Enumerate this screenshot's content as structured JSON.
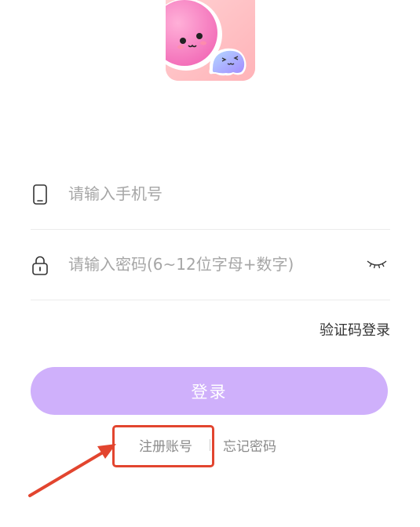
{
  "app": {
    "logo_icon": "ghost-mascot-logo-icon"
  },
  "phone_field": {
    "icon": "phone-icon",
    "placeholder": "请输入手机号",
    "value": ""
  },
  "password_field": {
    "icon": "lock-icon",
    "placeholder": "请输入密码(6~12位字母+数字)",
    "value": "",
    "toggle_icon": "eye-closed-icon"
  },
  "sms_login_label": "验证码登录",
  "login_button_label": "登录",
  "register_label": "注册账号",
  "forgot_password_label": "忘记密码",
  "colors": {
    "accent": "#cfb0fb",
    "annotation": "#e2452f",
    "placeholder": "#a6a6a6"
  }
}
